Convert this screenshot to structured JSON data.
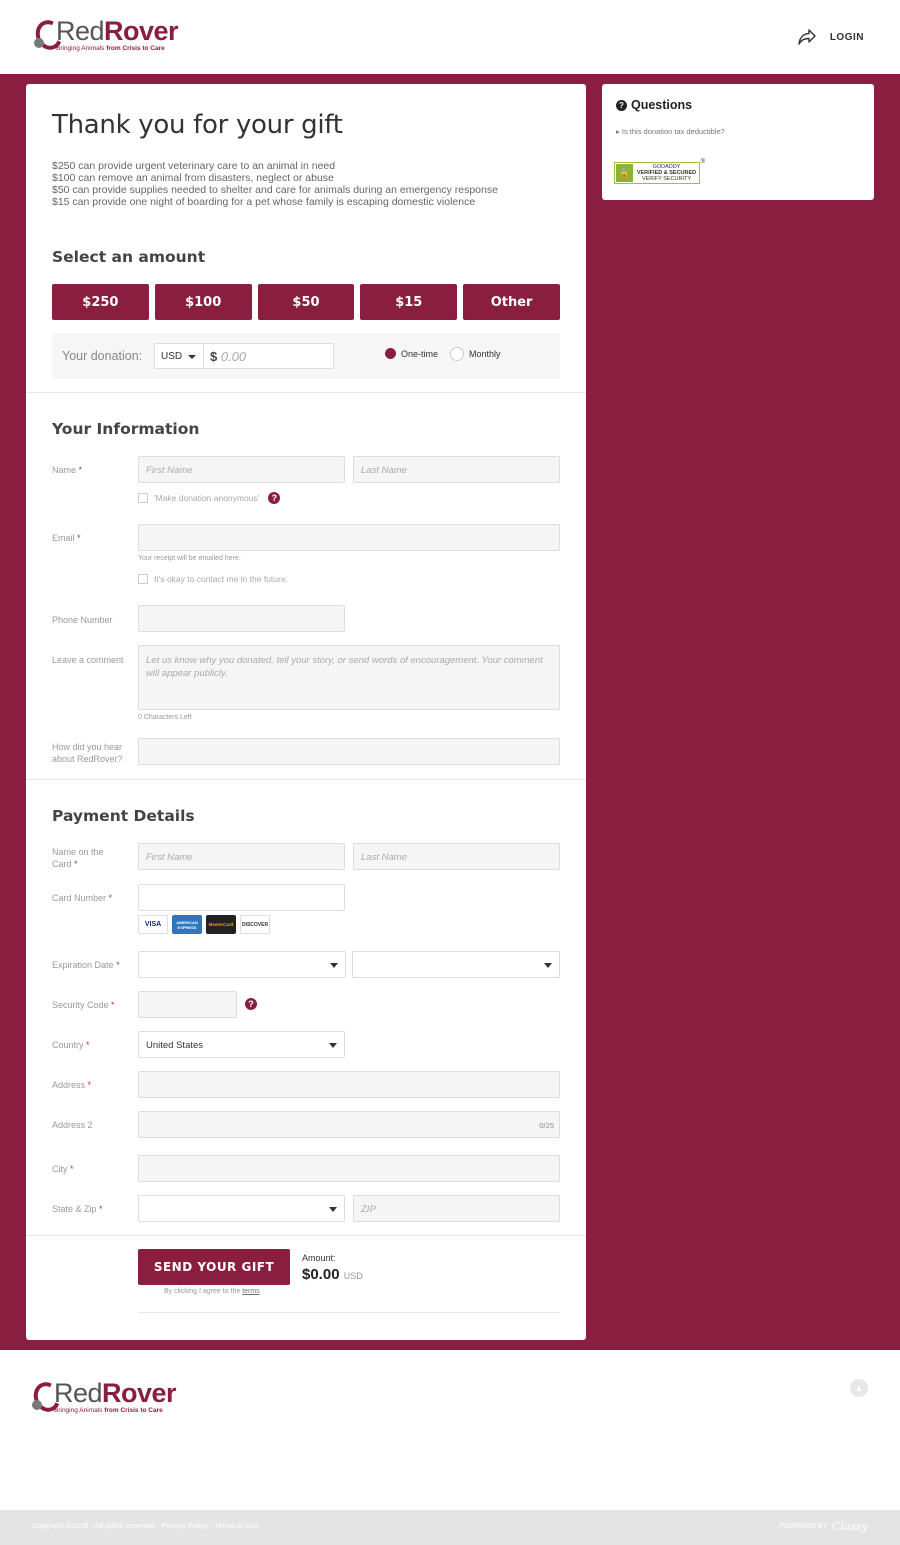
{
  "header": {
    "brand_part1": "Red",
    "brand_part2": "Rover",
    "tagline_pre": "Bringing Animals ",
    "tagline_bold": "from Crisis to Care",
    "login_label": "LOGIN"
  },
  "form": {
    "title": "Thank you for your gift",
    "impact_lines": [
      "$250 can provide urgent veterinary care to an animal in need",
      "$100 can remove an animal from disasters, neglect or abuse",
      "$50 can provide supplies needed to shelter and care for animals during an emergency response",
      "$15 can provide one night of boarding for a pet whose family is escaping domestic violence"
    ],
    "select_amount_heading": "Select an amount",
    "amount_buttons": [
      "$250",
      "$100",
      "$50",
      "$15",
      "Other"
    ],
    "donation_label": "Your donation:",
    "currency": "USD",
    "currency_symbol": "$",
    "amount_placeholder": "0.00",
    "frequency": {
      "one_time": "One-time",
      "monthly": "Monthly",
      "selected": "One-time"
    },
    "info_heading": "Your Information",
    "name_label": "Name",
    "first_name_placeholder": "First Name",
    "last_name_placeholder": "Last Name",
    "anonymous_label": "'Make donation anonymous'",
    "email_label": "Email",
    "email_hint": "Your receipt will be emailed here.",
    "contact_label": "It's okay to contact me in the future.",
    "phone_label": "Phone Number",
    "comment_label": "Leave a comment",
    "comment_placeholder": "Let us know why you donated, tell your story, or send words of encouragement. Your comment will appear publicly.",
    "chars_left": "0 Characters Left",
    "hear_label_1": "How did you hear",
    "hear_label_2": "about RedRover?",
    "payment_heading": "Payment Details",
    "name_on_card_1": "Name on the",
    "name_on_card_2": "Card",
    "card_first_placeholder": "First Name",
    "card_last_placeholder": "Last Name",
    "card_number_label": "Card Number",
    "card_brands": [
      "VISA",
      "AMERICAN EXPRESS",
      "MasterCard",
      "DISCOVER"
    ],
    "expiration_label": "Expiration Date",
    "security_label": "Security Code",
    "country_label": "Country",
    "country_value": "United States",
    "address_label": "Address",
    "address2_label": "Address 2",
    "address2_counter": "0/25",
    "city_label": "City",
    "state_zip_label": "State & Zip",
    "zip_placeholder": "ZIP",
    "required_mark": "*",
    "send_label": "SEND YOUR GIFT",
    "agree_text": "By clicking I agree to the ",
    "agree_link": "terms",
    "amount_label": "Amount:",
    "amount_total": "$0.00",
    "amount_currency": "USD"
  },
  "sidebar": {
    "questions_title": "Questions",
    "question_link": "Is this donation tax deductible?",
    "seal_line1": "GODADDY",
    "seal_line2": "VERIFIED & SECURED",
    "seal_line3": "VERIFY SECURITY",
    "seal_reg": "®"
  },
  "footer": {
    "copyright": "Copyright ©2018 · All rights reserved · Privacy Policy · Terms of Use",
    "powered_by": "POWERED BY",
    "classy": "Classy"
  },
  "colors": {
    "brand": "#8a1e41",
    "background_band": "#8a1e41",
    "footer_bar": "#e4e4e4"
  },
  "icons": [
    "share-icon",
    "question-circle-icon",
    "caret-down-icon",
    "lock-icon",
    "scroll-top-icon"
  ]
}
